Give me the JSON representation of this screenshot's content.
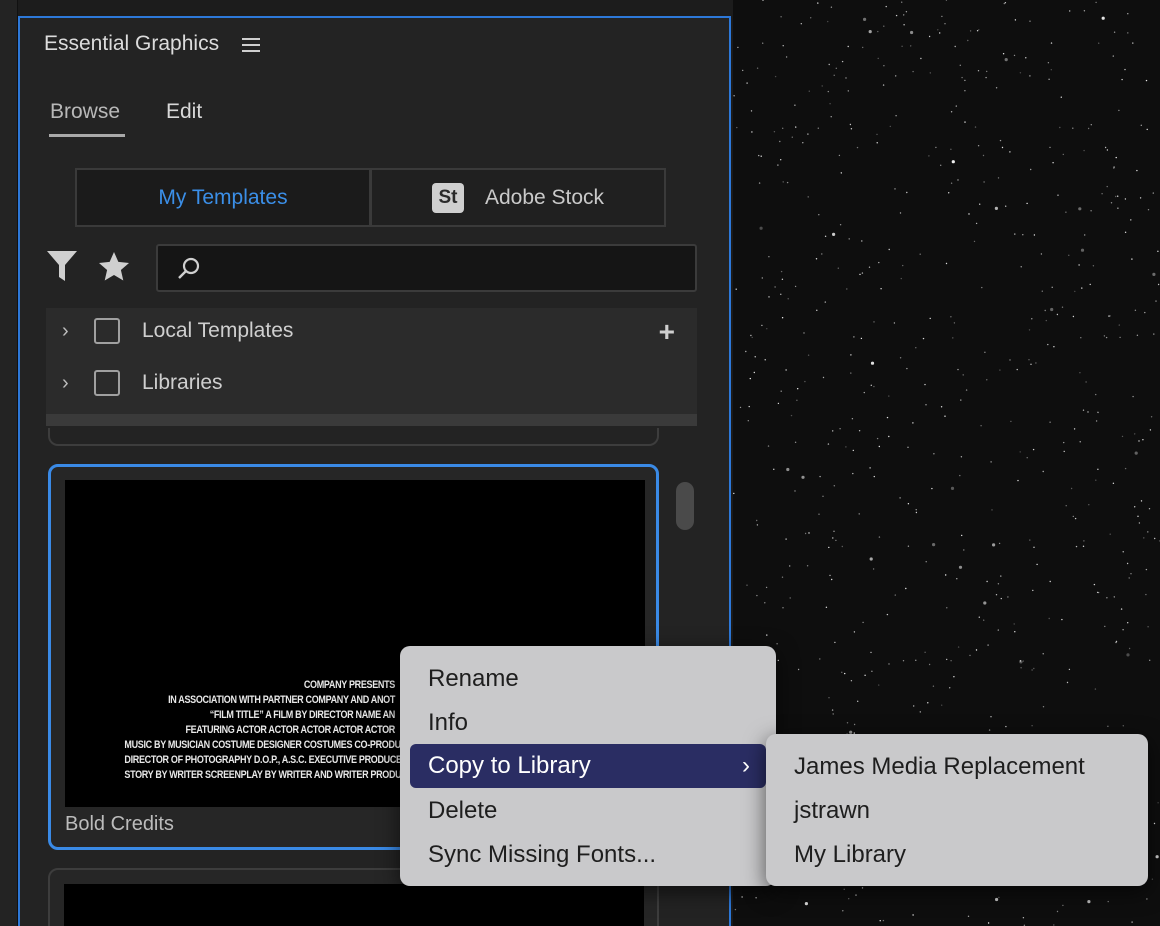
{
  "panel": {
    "title": "Essential Graphics",
    "tabs": [
      {
        "label": "Browse",
        "active": true
      },
      {
        "label": "Edit",
        "active": false
      }
    ],
    "segments": [
      {
        "label": "My Templates",
        "active": true
      },
      {
        "badge": "St",
        "label": "Adobe Stock",
        "active": false
      }
    ],
    "search": {
      "placeholder": ""
    },
    "tree": [
      {
        "label": "Local Templates",
        "checked": false
      },
      {
        "label": "Libraries",
        "checked": false
      }
    ],
    "template_card": {
      "label": "Bold Credits",
      "credits_lines": [
        "COMPANY PRESENTS",
        "IN ASSOCIATION WITH PARTNER COMPANY AND ANOT",
        "“FILM TITLE” A FILM BY DIRECTOR NAME AN",
        "FEATURING ACTOR ACTOR ACTOR ACTOR ACTOR",
        "MUSIC BY MUSICIAN COSTUME DESIGNER COSTUMES CO-PRODUCER CO-PRODU",
        "DIRECTOR OF PHOTOGRAPHY D.O.P., A.S.C. EXECUTIVE PRODUCERS PRODUCER P",
        "STORY BY WRITER SCREENPLAY BY WRITER AND WRITER PRODUCE"
      ]
    }
  },
  "context_menu": {
    "items": [
      {
        "label": "Rename",
        "active": false
      },
      {
        "label": "Info",
        "active": false
      },
      {
        "label": "Copy to Library",
        "active": true,
        "has_submenu": true
      },
      {
        "label": "Delete",
        "active": false
      },
      {
        "label": "Sync Missing Fonts...",
        "active": false
      }
    ]
  },
  "submenu": {
    "items": [
      {
        "label": "James Media Replacement"
      },
      {
        "label": "jstrawn"
      },
      {
        "label": "My Library"
      }
    ]
  },
  "colors": {
    "accent": "#3a8ae6",
    "menu_highlight": "#2a2d63",
    "menu_bg": "#c9c9cb",
    "panel_bg": "#232323"
  }
}
